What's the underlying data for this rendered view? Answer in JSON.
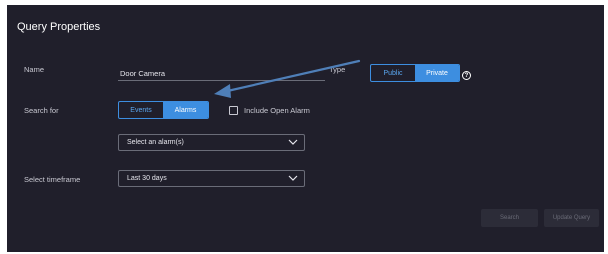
{
  "title": "Query Properties",
  "name": {
    "label": "Name",
    "value": "Door Camera"
  },
  "type": {
    "label": "Type",
    "options": [
      "Public",
      "Private"
    ],
    "selected": "Private"
  },
  "search_for": {
    "label": "Search for",
    "options": [
      "Events",
      "Alarms"
    ],
    "selected": "Alarms",
    "include_open_alarm": {
      "label": "Include Open Alarm",
      "checked": false
    },
    "alarm_select": {
      "value": "Select an alarm(s)"
    }
  },
  "timeframe": {
    "label": "Select timeframe",
    "value": "Last 30 days"
  },
  "buttons": {
    "search": "Search",
    "update": "Update Query"
  },
  "colors": {
    "panel_bg": "#201f2b",
    "accent": "#3d8ee0",
    "annotation_arrow": "#4f7fb8"
  },
  "icons": {
    "help": "?",
    "dropdown": "chevron-down-icon",
    "annotation": "arrow-annotation"
  }
}
